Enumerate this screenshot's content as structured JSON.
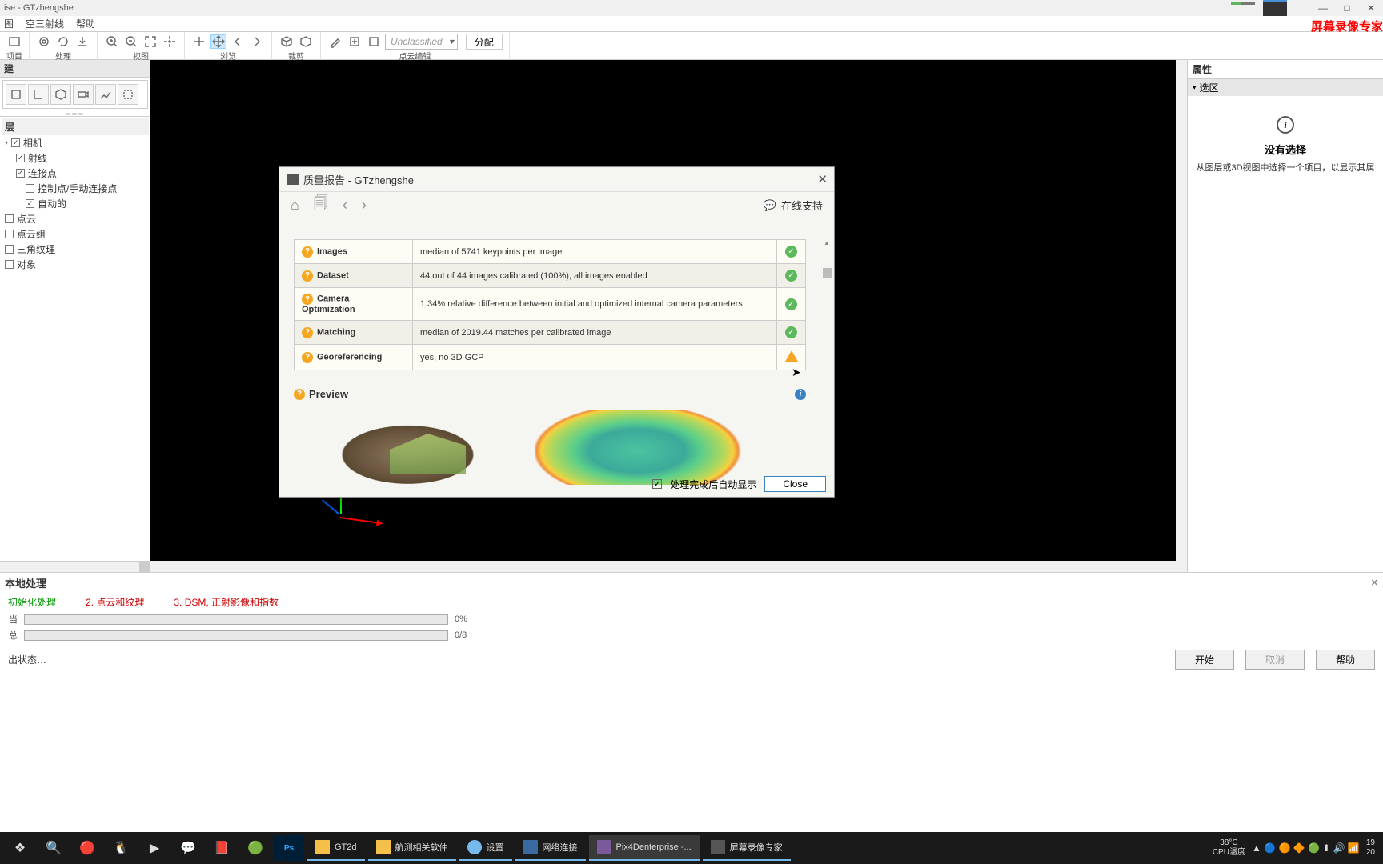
{
  "titlebar": "ise - GTzhengshe",
  "menubar": [
    "图",
    "空三射线",
    "帮助"
  ],
  "screenRecorder": "屏幕录像专家",
  "toolGroups": {
    "project": "项目",
    "process": "处理",
    "view": "视图",
    "browse": "浏览",
    "crop": "裁剪",
    "pointEdit": "点云编辑",
    "unclassified": "Unclassified",
    "assign": "分配"
  },
  "createPanel": {
    "title": "建"
  },
  "tree": {
    "title": "层",
    "items": [
      {
        "cb": true,
        "label": "相机",
        "exp": true
      },
      {
        "cb": true,
        "label": "射线",
        "indent": true
      },
      {
        "cb": true,
        "label": "连接点",
        "indent": true
      },
      {
        "cb": false,
        "label": "控制点/手动连接点",
        "indent": true,
        "sub": true
      },
      {
        "cb": true,
        "label": "自动的",
        "indent": true,
        "sub": true
      },
      {
        "cb": false,
        "label": "点云"
      },
      {
        "cb": false,
        "label": "点云组"
      },
      {
        "cb": false,
        "label": "三角纹理"
      },
      {
        "cb": false,
        "label": "对象"
      }
    ]
  },
  "rightPanel": {
    "prop": "属性",
    "selection": "选区",
    "noSel": "没有选择",
    "noSelHint": "从图层或3D视图中选择一个项目，以显示其属"
  },
  "dialog": {
    "title": "质量报告 - GTzhengshe",
    "support": "在线支持",
    "rows": [
      {
        "label": "Images",
        "value": "median of 5741 keypoints per image",
        "status": "ok"
      },
      {
        "label": "Dataset",
        "value": "44 out of 44 images calibrated (100%), all images enabled",
        "status": "ok"
      },
      {
        "label": "Camera Optimization",
        "value": "1.34% relative difference between initial and optimized internal camera parameters",
        "status": "ok"
      },
      {
        "label": "Matching",
        "value": "median of 2019.44 matches per calibrated image",
        "status": "ok"
      },
      {
        "label": "Georeferencing",
        "value": "yes, no 3D GCP",
        "status": "warn"
      }
    ],
    "preview": "Preview",
    "autoShow": "处理完成后自动显示",
    "close": "Close"
  },
  "proc": {
    "title": "本地处理",
    "step1": "初始化处理",
    "step2": "2. 点云和纹理",
    "step3": "3. DSM, 正射影像和指数",
    "lbl1": "当",
    "lbl2": "总",
    "p1": "0%",
    "p2": "0/8",
    "status": "出状态…",
    "start": "开始",
    "cancel": "取消",
    "help": "帮助"
  },
  "taskbar": {
    "tasks": [
      {
        "label": "GT2d",
        "cls": "folder"
      },
      {
        "label": "航测相关软件",
        "cls": "folder"
      },
      {
        "label": "设置",
        "cls": "gear"
      },
      {
        "label": "网络连接",
        "cls": "net"
      },
      {
        "label": "Pix4Denterprise -...",
        "cls": "pix",
        "active": true
      },
      {
        "label": "屏幕录像专家",
        "cls": "default"
      }
    ],
    "temp1": "38°C",
    "temp2": "CPU温度",
    "time1": "19",
    "time2": "20"
  }
}
